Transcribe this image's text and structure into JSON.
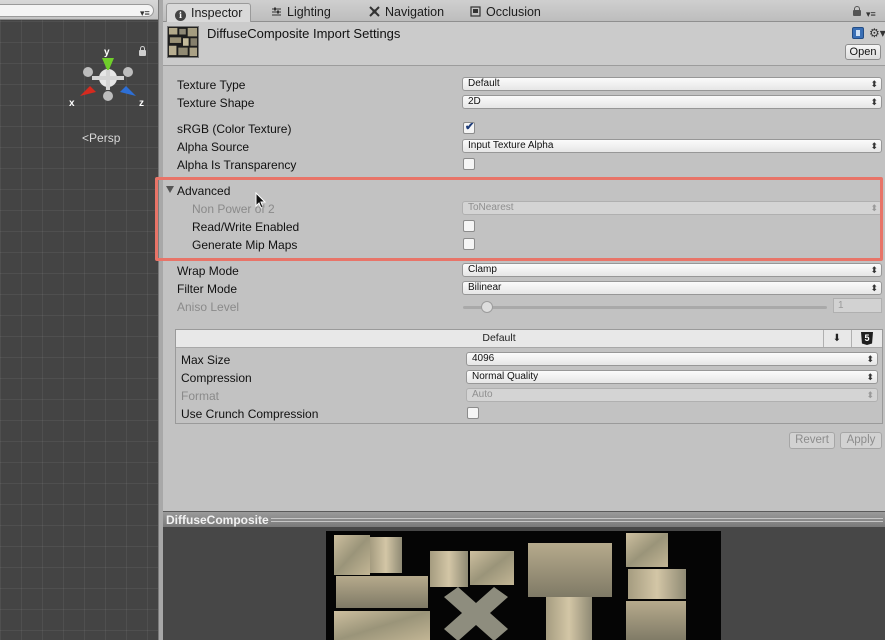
{
  "scene": {
    "gizmo_x": "x",
    "gizmo_y": "y",
    "gizmo_z": "z",
    "persp_label": "Persp",
    "menu_glyph": "▾≡",
    "colors": {
      "x_axis": "#d62a1e",
      "y_axis": "#6fcf2a",
      "z_axis": "#2d6fd6"
    }
  },
  "tabs": [
    {
      "label": "Inspector",
      "icon": "info-icon",
      "active": true
    },
    {
      "label": "Lighting",
      "icon": "lighting-icon",
      "active": false
    },
    {
      "label": "Navigation",
      "icon": "navigation-icon",
      "active": false
    },
    {
      "label": "Occlusion",
      "icon": "occlusion-icon",
      "active": false
    }
  ],
  "tab_menu_glyph": "▾≡",
  "header": {
    "title": "DiffuseComposite Import Settings",
    "open_label": "Open",
    "gear_glyph": "⚙▾"
  },
  "settings": {
    "texture_type": {
      "label": "Texture Type",
      "value": "Default"
    },
    "texture_shape": {
      "label": "Texture Shape",
      "value": "2D"
    },
    "srgb": {
      "label": "sRGB (Color Texture)",
      "checked": true
    },
    "alpha_source": {
      "label": "Alpha Source",
      "value": "Input Texture Alpha"
    },
    "alpha_is_transparency": {
      "label": "Alpha Is Transparency",
      "checked": false
    },
    "advanced": {
      "label": "Advanced",
      "non_power_of_2": {
        "label": "Non Power of 2",
        "value": "ToNearest"
      },
      "read_write": {
        "label": "Read/Write Enabled",
        "checked": false
      },
      "generate_mip_maps": {
        "label": "Generate Mip Maps",
        "checked": false
      }
    },
    "wrap_mode": {
      "label": "Wrap Mode",
      "value": "Clamp"
    },
    "filter_mode": {
      "label": "Filter Mode",
      "value": "Bilinear"
    },
    "aniso_level": {
      "label": "Aniso Level",
      "value": "1",
      "fraction": 0.05
    }
  },
  "platform": {
    "default_tab": "Default",
    "download_glyph": "⬇",
    "max_size": {
      "label": "Max Size",
      "value": "4096"
    },
    "compression": {
      "label": "Compression",
      "value": "Normal Quality"
    },
    "format": {
      "label": "Format",
      "value": "Auto"
    },
    "use_crunch": {
      "label": "Use Crunch Compression",
      "checked": false
    }
  },
  "buttons": {
    "revert": "Revert",
    "apply": "Apply"
  },
  "preview": {
    "title": "DiffuseComposite"
  },
  "highlight_color": "#e87468"
}
